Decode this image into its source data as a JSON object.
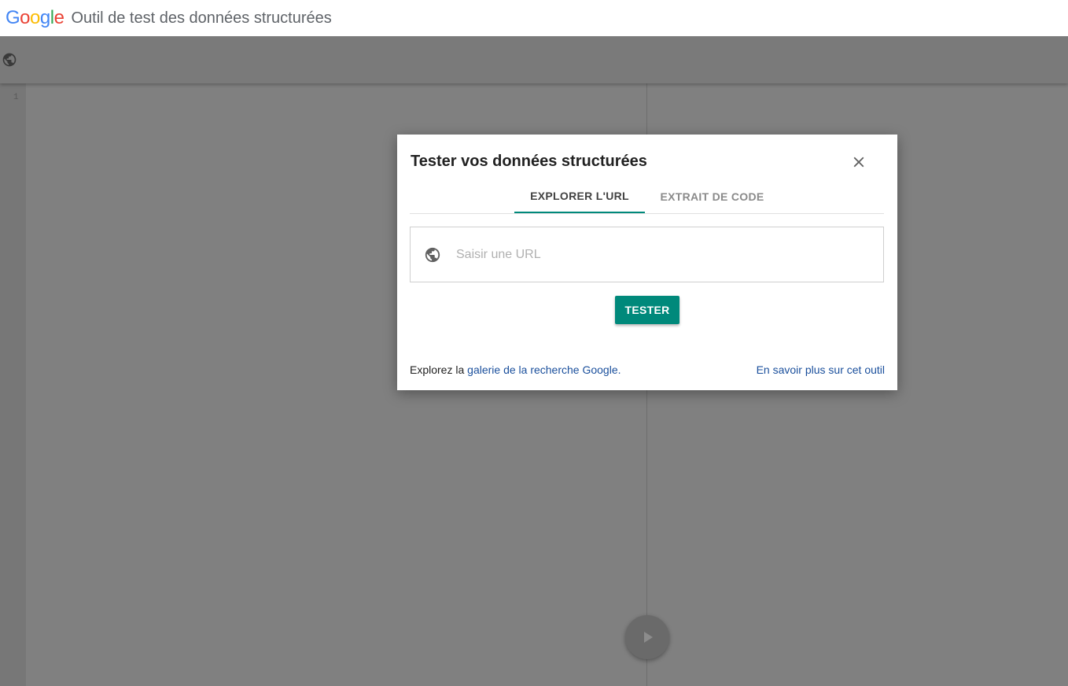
{
  "header": {
    "logo_letters": [
      {
        "char": "G",
        "color": "#4285F4"
      },
      {
        "char": "o",
        "color": "#EA4335"
      },
      {
        "char": "o",
        "color": "#FBBC05"
      },
      {
        "char": "g",
        "color": "#4285F4"
      },
      {
        "char": "l",
        "color": "#34A853"
      },
      {
        "char": "e",
        "color": "#EA4335"
      }
    ],
    "title": "Outil de test des données structurées"
  },
  "toolbar": {
    "icon": "globe-icon"
  },
  "editor": {
    "line_number": "1",
    "run_icon": "play-icon"
  },
  "dialog": {
    "title": "Tester vos données structurées",
    "close_icon": "close-icon",
    "tabs": [
      {
        "label": "EXPLORER L'URL",
        "active": true
      },
      {
        "label": "EXTRAIT DE CODE",
        "active": false
      }
    ],
    "url_input": {
      "placeholder": "Saisir une URL",
      "value": "",
      "icon": "globe-icon"
    },
    "test_button_label": "TESTER",
    "footer": {
      "prefix": "Explorez la ",
      "gallery_link": "galerie de la recherche Google.",
      "learn_more_link": "En savoir plus sur cet outil"
    }
  },
  "colors": {
    "accent": "#00897b",
    "link": "#1a4f9c",
    "overlay": "#808080"
  }
}
